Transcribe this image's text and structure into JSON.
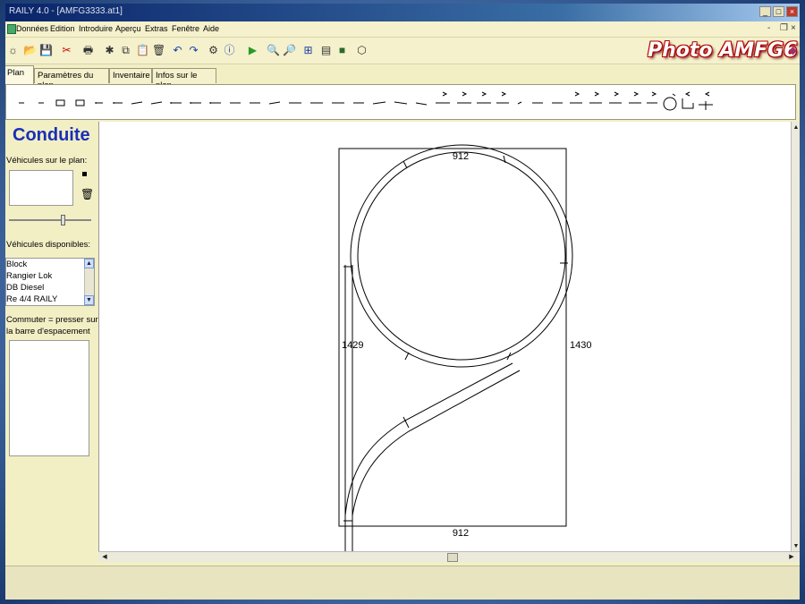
{
  "window": {
    "title": "RAILY 4.0 - [AMFG3333.at1]",
    "min_glyph": "_",
    "max_glyph": "□",
    "close_glyph": "×",
    "mdi_min_glyph": "-",
    "mdi_restore_glyph": "❐",
    "mdi_close_glyph": "×"
  },
  "menu": {
    "items": [
      "Données",
      "Edition",
      "Introduire",
      "Aperçu",
      "Extras",
      "Fenêtre",
      "Aide"
    ]
  },
  "toolbar": {
    "icons": [
      "new-icon",
      "open-icon",
      "save-icon",
      "cut-icon",
      "print-icon",
      "find-icon",
      "copy-icon",
      "paste-icon",
      "delete-icon",
      "rotate-left-icon",
      "rotate-right-icon",
      "tool-icon",
      "tool-info-icon",
      "run-icon",
      "zoom-in-icon",
      "zoom-out-icon",
      "zoom-fit-icon",
      "measure-icon",
      "color-icon",
      "3d-view-icon"
    ],
    "glyphs": [
      "☼",
      "📂",
      "💾",
      "✂",
      "🖶",
      "✱",
      "⧉",
      "📋",
      "🗑",
      "↶",
      "↷",
      "⚙",
      "ⓘ",
      "▶",
      "🔍",
      "🔎",
      "⊞",
      "▤",
      "■",
      "⬡"
    ],
    "logo_text": "Photo AMFG6"
  },
  "tabs": [
    "Plan",
    "Paramètres du plan",
    "Inventaire",
    "Infos sur le plan"
  ],
  "left_panel": {
    "title": "Conduite",
    "vehicles_on_plan_label": "Véhicules sur le plan:",
    "available_vehicles_label": "Véhicules disponibles:",
    "available_vehicles": [
      "Block",
      "Rangier Lok",
      "DB Diesel",
      "Re 4/4 RAILY"
    ],
    "hint_label_line1": "Commuter = presser sur",
    "hint_label_line2": "la barre d'espacement"
  },
  "layout": {
    "width_top_label": "912",
    "width_bottom_label": "912",
    "height_left_label": "1429",
    "height_right_label": "1430"
  },
  "colors": {
    "window_bg": "#f2efc5",
    "title_accent": "#1a2fb8",
    "logo_red": "#b30000",
    "frame_blue": "#1d3f74"
  }
}
